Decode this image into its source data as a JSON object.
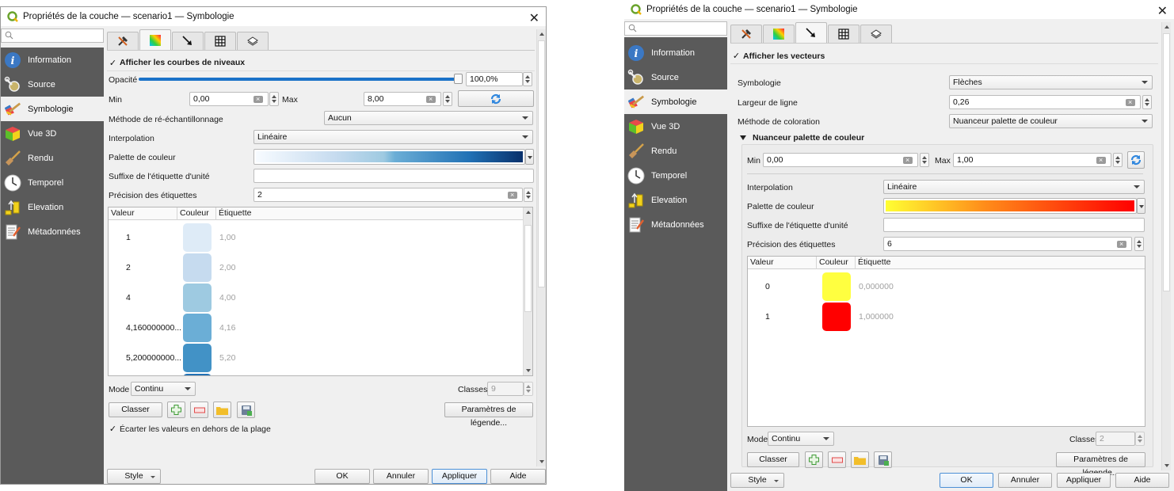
{
  "left_window": {
    "title": "Propriétés de la couche — scenario1 — Symbologie",
    "search_placeholder": "",
    "sidebar": [
      {
        "label": "Information",
        "icon": "info-icon"
      },
      {
        "label": "Source",
        "icon": "source-icon"
      },
      {
        "label": "Symbologie",
        "icon": "symbology-icon",
        "active": true
      },
      {
        "label": "Vue 3D",
        "icon": "3d-cube-icon"
      },
      {
        "label": "Rendu",
        "icon": "brush-icon"
      },
      {
        "label": "Temporel",
        "icon": "clock-icon"
      },
      {
        "label": "Elevation",
        "icon": "elevation-icon"
      },
      {
        "label": "Métadonnées",
        "icon": "metadata-icon"
      }
    ],
    "tabs": [
      {
        "icon": "hammer-icon"
      },
      {
        "icon": "contours-gradient-icon",
        "active": true
      },
      {
        "icon": "vector-arrow-icon"
      },
      {
        "icon": "mesh-grid-icon"
      },
      {
        "icon": "layers-icon"
      }
    ],
    "show_checkbox": {
      "label": "Afficher les courbes de niveaux",
      "checked": true
    },
    "opacity": {
      "label": "Opacité",
      "value": "100,0%",
      "fraction": 1.0
    },
    "min": {
      "label": "Min",
      "value": "0,00"
    },
    "max": {
      "label": "Max",
      "value": "8,00"
    },
    "resampling": {
      "label": "Méthode de ré-échantillonnage",
      "value": "Aucun"
    },
    "interpolation": {
      "label": "Interpolation",
      "value": "Linéaire"
    },
    "palette": {
      "label": "Palette de couleur",
      "from": "#f7fbff",
      "to": "#08306b"
    },
    "unit_suffix": {
      "label": "Suffixe de l'étiquette d'unité",
      "value": ""
    },
    "precision": {
      "label": "Précision des étiquettes",
      "value": "2"
    },
    "table": {
      "headers": [
        "Valeur",
        "Couleur",
        "Étiquette"
      ],
      "rows": [
        {
          "value": "1",
          "color": "#deebf7",
          "label": "1,00"
        },
        {
          "value": "2",
          "color": "#c6dbef",
          "label": "2,00"
        },
        {
          "value": "4",
          "color": "#9ecae1",
          "label": "4,00"
        },
        {
          "value": "4,160000000...",
          "color": "#6baed6",
          "label": "4,16"
        },
        {
          "value": "5,200000000...",
          "color": "#4292c6",
          "label": "5,20"
        },
        {
          "value": "",
          "color": "#2171b5",
          "label": ""
        }
      ]
    },
    "mode": {
      "label": "Mode",
      "value": "Continu"
    },
    "classes": {
      "label": "Classes",
      "value": "9"
    },
    "classify_label": "Classer",
    "legend_settings_label": "Paramètres de légende...",
    "clip_checkbox": {
      "label": "Écarter les valeurs en dehors de la plage",
      "checked": true
    },
    "footer": {
      "style": "Style",
      "ok": "OK",
      "cancel": "Annuler",
      "apply": "Appliquer",
      "help": "Aide"
    }
  },
  "right_window": {
    "title": "Propriétés de la couche — scenario1 — Symbologie",
    "search_placeholder": "",
    "sidebar": [
      {
        "label": "Information",
        "icon": "info-icon"
      },
      {
        "label": "Source",
        "icon": "source-icon"
      },
      {
        "label": "Symbologie",
        "icon": "symbology-icon",
        "active": true
      },
      {
        "label": "Vue 3D",
        "icon": "3d-cube-icon"
      },
      {
        "label": "Rendu",
        "icon": "brush-icon"
      },
      {
        "label": "Temporel",
        "icon": "clock-icon"
      },
      {
        "label": "Elevation",
        "icon": "elevation-icon"
      },
      {
        "label": "Métadonnées",
        "icon": "metadata-icon"
      }
    ],
    "tabs": [
      {
        "icon": "hammer-icon"
      },
      {
        "icon": "contours-gradient-icon"
      },
      {
        "icon": "vector-arrow-icon",
        "active": true
      },
      {
        "icon": "mesh-grid-icon"
      },
      {
        "icon": "layers-icon"
      }
    ],
    "show_checkbox": {
      "label": "Afficher les vecteurs",
      "checked": true
    },
    "symbology": {
      "label": "Symbologie",
      "value": "Flèches"
    },
    "line_width": {
      "label": "Largeur de ligne",
      "value": "0,26"
    },
    "coloring": {
      "label": "Méthode de coloration",
      "value": "Nuanceur palette de couleur"
    },
    "group_title": "Nuanceur palette de couleur",
    "min": {
      "label": "Min",
      "value": "0,00"
    },
    "max": {
      "label": "Max",
      "value": "1,00"
    },
    "interpolation": {
      "label": "Interpolation",
      "value": "Linéaire"
    },
    "palette": {
      "label": "Palette de couleur",
      "from": "#ffff33",
      "mid": "#ff8c1a",
      "to": "#ff0000"
    },
    "unit_suffix": {
      "label": "Suffixe de l'étiquette d'unité",
      "value": ""
    },
    "precision": {
      "label": "Précision des étiquettes",
      "value": "6"
    },
    "table": {
      "headers": [
        "Valeur",
        "Couleur",
        "Étiquette"
      ],
      "rows": [
        {
          "value": "0",
          "color": "#ffff40",
          "label": "0,000000"
        },
        {
          "value": "1",
          "color": "#ff0000",
          "label": "1,000000"
        }
      ]
    },
    "mode": {
      "label": "Mode",
      "value": "Continu"
    },
    "classes": {
      "label": "Classes",
      "value": "2"
    },
    "classify_label": "Classer",
    "legend_settings_label": "Paramètres de légende...",
    "footer": {
      "style": "Style",
      "ok": "OK",
      "cancel": "Annuler",
      "apply": "Appliquer",
      "help": "Aide"
    }
  }
}
